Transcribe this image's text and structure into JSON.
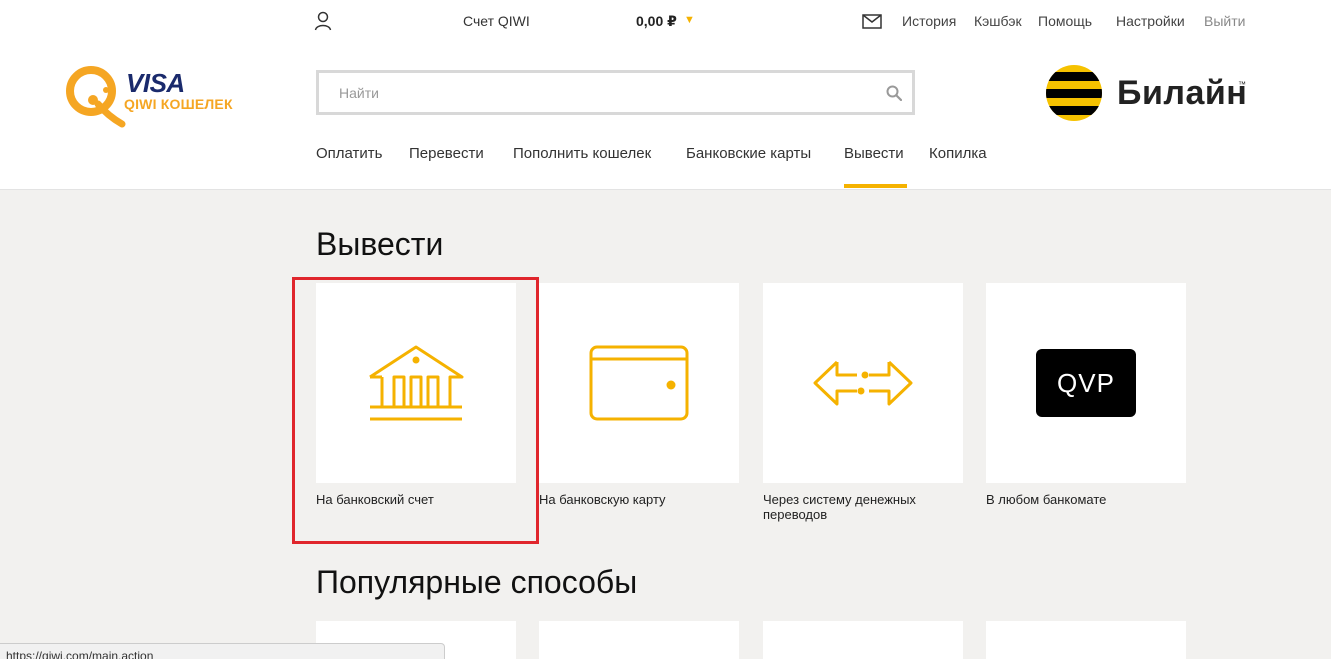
{
  "topbar": {
    "account_label": "Счет QIWI",
    "balance": "0,00 ₽",
    "balance_caret": "▼",
    "links": {
      "history": "История",
      "cashback": "Кэшбэк",
      "help": "Помощь",
      "settings": "Настройки",
      "logout": "Выйти"
    }
  },
  "logo": {
    "visa": "VISA",
    "qiwi": "QIWI КОШЕЛЕК"
  },
  "search": {
    "placeholder": "Найти",
    "value": ""
  },
  "partner": {
    "name": "Билайн",
    "tm": "™"
  },
  "mainnav": {
    "items": [
      {
        "label": "Оплатить"
      },
      {
        "label": "Перевести"
      },
      {
        "label": "Пополнить кошелек"
      },
      {
        "label": "Банковские карты"
      },
      {
        "label": "Вывести",
        "active": true
      },
      {
        "label": "Копилка"
      }
    ]
  },
  "withdraw": {
    "title": "Вывести",
    "tiles": [
      {
        "label": "На банковский счет",
        "icon": "bank-icon"
      },
      {
        "label": "На банковскую карту",
        "icon": "card-icon"
      },
      {
        "label": "Через систему денежных переводов",
        "icon": "transfer-arrows-icon"
      },
      {
        "label": "В любом банкомате",
        "icon": "qvp-icon",
        "badge": "QVP"
      }
    ]
  },
  "popular": {
    "title": "Популярные способы"
  },
  "statusbar": {
    "url": "https://qiwi.com/main.action"
  },
  "colors": {
    "accent_yellow": "#f5b200",
    "highlight_red": "#e0262c",
    "qiwi_orange": "#f5a623",
    "visa_blue": "#1a2a6c",
    "background": "#f2f1ef"
  }
}
